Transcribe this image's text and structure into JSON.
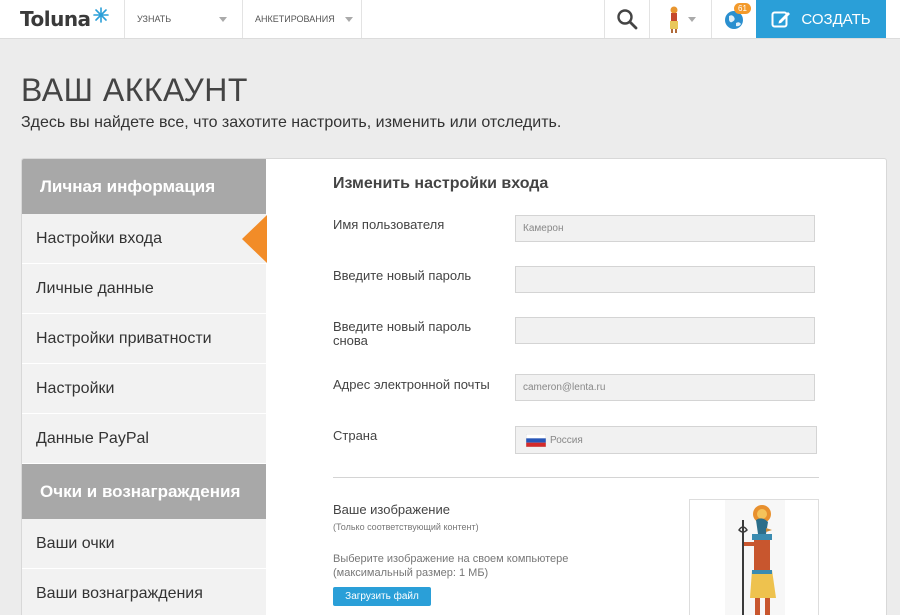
{
  "topbar": {
    "logo": "Toluna",
    "nav": [
      "УЗНАТЬ",
      "АНКЕТИРОВАНИЯ"
    ],
    "notification_count": "61",
    "create_label": "СОЗДАТЬ",
    "accent_color": "#2a9fd8",
    "badge_color": "#f39a2b",
    "icons": [
      "search-icon",
      "avatar",
      "globe-icon",
      "pencil-icon"
    ]
  },
  "page": {
    "title": "ВАШ АККАУНТ",
    "subtitle": "Здесь вы найдете все, что захотите настроить, изменить или отследить."
  },
  "sidebar": {
    "section1": "Личная информация",
    "items1": [
      "Настройки входа",
      "Личные данные",
      "Настройки приватности",
      "Настройки",
      "Данные PayPal"
    ],
    "section2": "Очки и вознаграждения",
    "items2": [
      "Ваши очки",
      "Ваши вознаграждения"
    ],
    "active_index": 0,
    "active_color": "#f28c28"
  },
  "form": {
    "title": "Изменить настройки входа",
    "username_label": "Имя пользователя",
    "username_value": "Камерон",
    "password_label": "Введите новый пароль",
    "password_repeat_label": "Введите новый пароль снова",
    "email_label": "Адрес электронной почты",
    "email_value": "cameron@lenta.ru",
    "country_label": "Страна",
    "country_value": "Россия",
    "image_label": "Ваше изображение",
    "image_note": "(Только соответствующий контент)",
    "image_help": "Выберите изображение на своем компьютере (максимальный размер: 1 МБ)",
    "upload_label": "Загрузить файл"
  }
}
